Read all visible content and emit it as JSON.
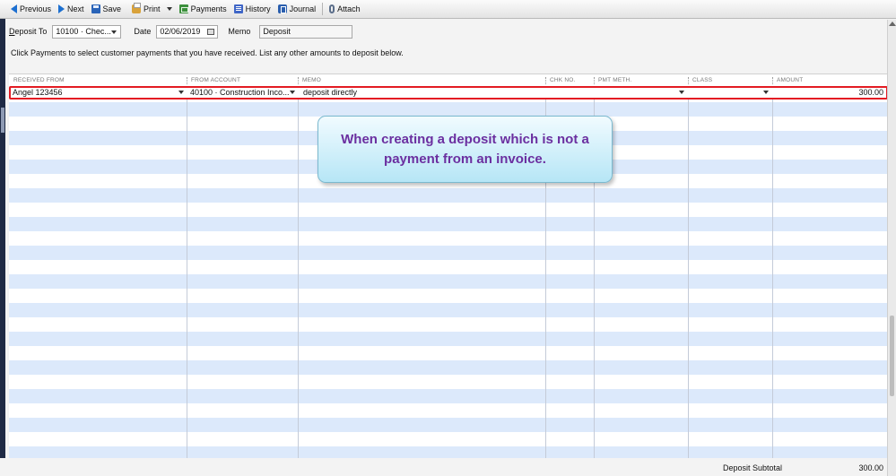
{
  "toolbar": {
    "previous": "Previous",
    "next": "Next",
    "save": "Save",
    "print": "Print",
    "payments": "Payments",
    "history": "History",
    "journal": "Journal",
    "attach": "Attach"
  },
  "form": {
    "deposit_to_label_key": "D",
    "deposit_to_label_rest": "eposit To",
    "deposit_to_value": "10100 · Chec...",
    "date_label": "Date",
    "date_value": "02/06/2019",
    "memo_label": "Memo",
    "memo_value": "Deposit"
  },
  "instructions": "Click Payments to select customer payments that you have received. List any other amounts to deposit below.",
  "grid": {
    "columns": [
      "RECEIVED FROM",
      "FROM ACCOUNT",
      "MEMO",
      "CHK NO.",
      "PMT METH.",
      "CLASS",
      "AMOUNT"
    ],
    "rows": [
      {
        "received_from": "Angel 123456",
        "from_account": "40100 · Construction Inco...",
        "memo": "deposit directly",
        "chk_no": "",
        "pmt_meth": "",
        "class": "",
        "amount": "300.00"
      }
    ]
  },
  "callout": {
    "text": "When creating a deposit which is not a payment from an invoice."
  },
  "footer": {
    "subtotal_label": "Deposit Subtotal",
    "subtotal_value": "300.00"
  },
  "colors": {
    "highlight_border": "#e31b23",
    "row_stripe": "#dce9fb",
    "callout_text": "#6b2fa0",
    "callout_fill": "#b6e6f6"
  }
}
